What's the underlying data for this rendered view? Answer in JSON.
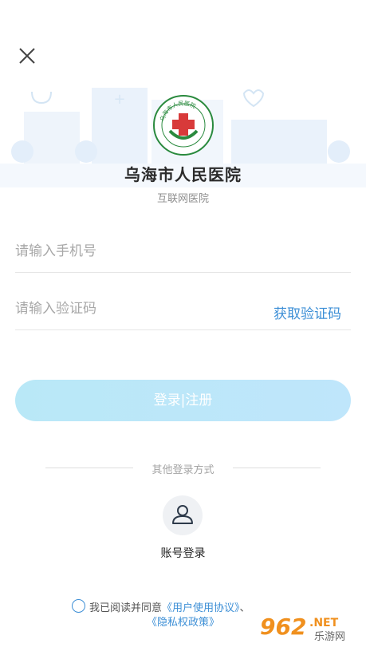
{
  "header": {
    "close_icon": "close-icon"
  },
  "hospital": {
    "name": "乌海市人民医院",
    "subtitle": "互联网医院",
    "logo_ring_text": "乌海市人民医院"
  },
  "form": {
    "phone_placeholder": "请输入手机号",
    "code_placeholder": "请输入验证码",
    "get_code_label": "获取验证码",
    "login_label": "登录|注册"
  },
  "other_login": {
    "divider_text": "其他登录方式",
    "account_icon": "user-icon",
    "account_label": "账号登录"
  },
  "agreement": {
    "prefix": "我已阅读并同意",
    "user_agreement": "《用户使用协议》",
    "separator": "、",
    "privacy_policy": "《隐私权政策》"
  },
  "watermark": {
    "brand": "962",
    "domain": ".NET",
    "site": "乐游网"
  },
  "colors": {
    "accent": "#3d8fd6",
    "button_gradient_start": "#b9e8f7",
    "button_gradient_end": "#bfe6fb",
    "watermark_orange": "#f0901e"
  }
}
